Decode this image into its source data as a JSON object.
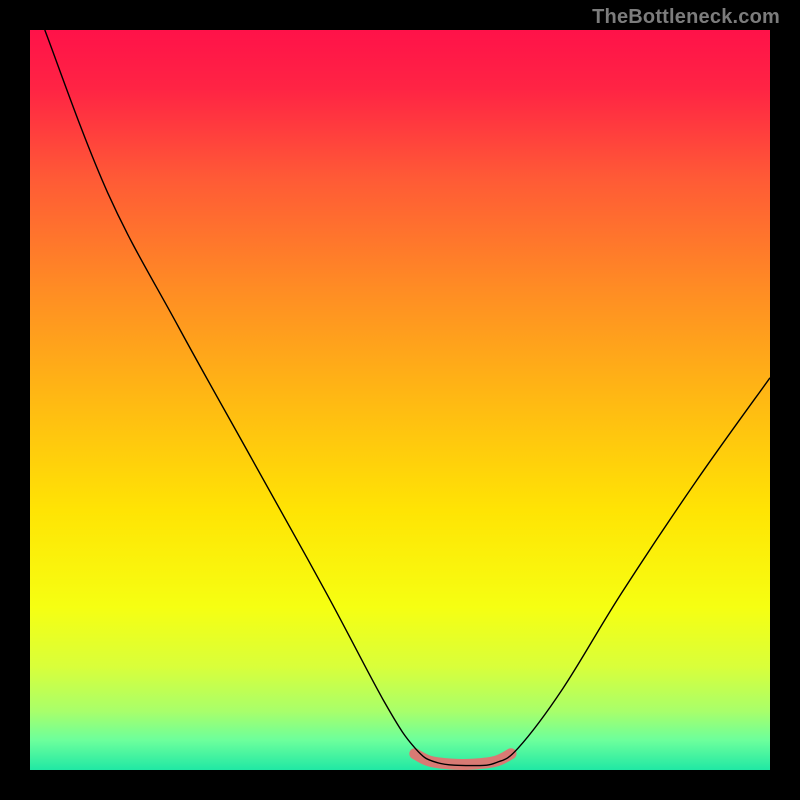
{
  "watermark": "TheBottleneck.com",
  "chart_data": {
    "type": "line",
    "title": "",
    "xlabel": "",
    "ylabel": "",
    "xlim": [
      0,
      100
    ],
    "ylim": [
      0,
      100
    ],
    "grid": false,
    "gradient_stops": [
      {
        "offset": 0.0,
        "color": "#ff1249"
      },
      {
        "offset": 0.08,
        "color": "#ff2444"
      },
      {
        "offset": 0.2,
        "color": "#ff5a36"
      },
      {
        "offset": 0.35,
        "color": "#ff8c24"
      },
      {
        "offset": 0.5,
        "color": "#ffb913"
      },
      {
        "offset": 0.65,
        "color": "#ffe404"
      },
      {
        "offset": 0.78,
        "color": "#f6ff12"
      },
      {
        "offset": 0.86,
        "color": "#d9ff3a"
      },
      {
        "offset": 0.92,
        "color": "#a9ff6a"
      },
      {
        "offset": 0.96,
        "color": "#6cff9c"
      },
      {
        "offset": 1.0,
        "color": "#20e8a4"
      }
    ],
    "series": [
      {
        "name": "bottleneck-curve",
        "color": "#000000",
        "width": 1.4,
        "points": [
          {
            "x": 2.0,
            "y": 100.0
          },
          {
            "x": 10.5,
            "y": 78.0
          },
          {
            "x": 20.0,
            "y": 60.0
          },
          {
            "x": 30.0,
            "y": 42.0
          },
          {
            "x": 40.0,
            "y": 24.0
          },
          {
            "x": 48.0,
            "y": 9.0
          },
          {
            "x": 52.0,
            "y": 3.0
          },
          {
            "x": 55.0,
            "y": 1.0
          },
          {
            "x": 60.0,
            "y": 0.6
          },
          {
            "x": 63.0,
            "y": 1.0
          },
          {
            "x": 66.0,
            "y": 3.0
          },
          {
            "x": 72.0,
            "y": 11.0
          },
          {
            "x": 80.0,
            "y": 24.0
          },
          {
            "x": 90.0,
            "y": 39.0
          },
          {
            "x": 100.0,
            "y": 53.0
          }
        ]
      },
      {
        "name": "flat-highlight",
        "color": "#d87a74",
        "width": 11,
        "linecap": "round",
        "points": [
          {
            "x": 52.0,
            "y": 2.2
          },
          {
            "x": 54.0,
            "y": 1.2
          },
          {
            "x": 57.0,
            "y": 0.8
          },
          {
            "x": 60.0,
            "y": 0.8
          },
          {
            "x": 63.0,
            "y": 1.2
          },
          {
            "x": 65.0,
            "y": 2.2
          }
        ]
      }
    ]
  }
}
